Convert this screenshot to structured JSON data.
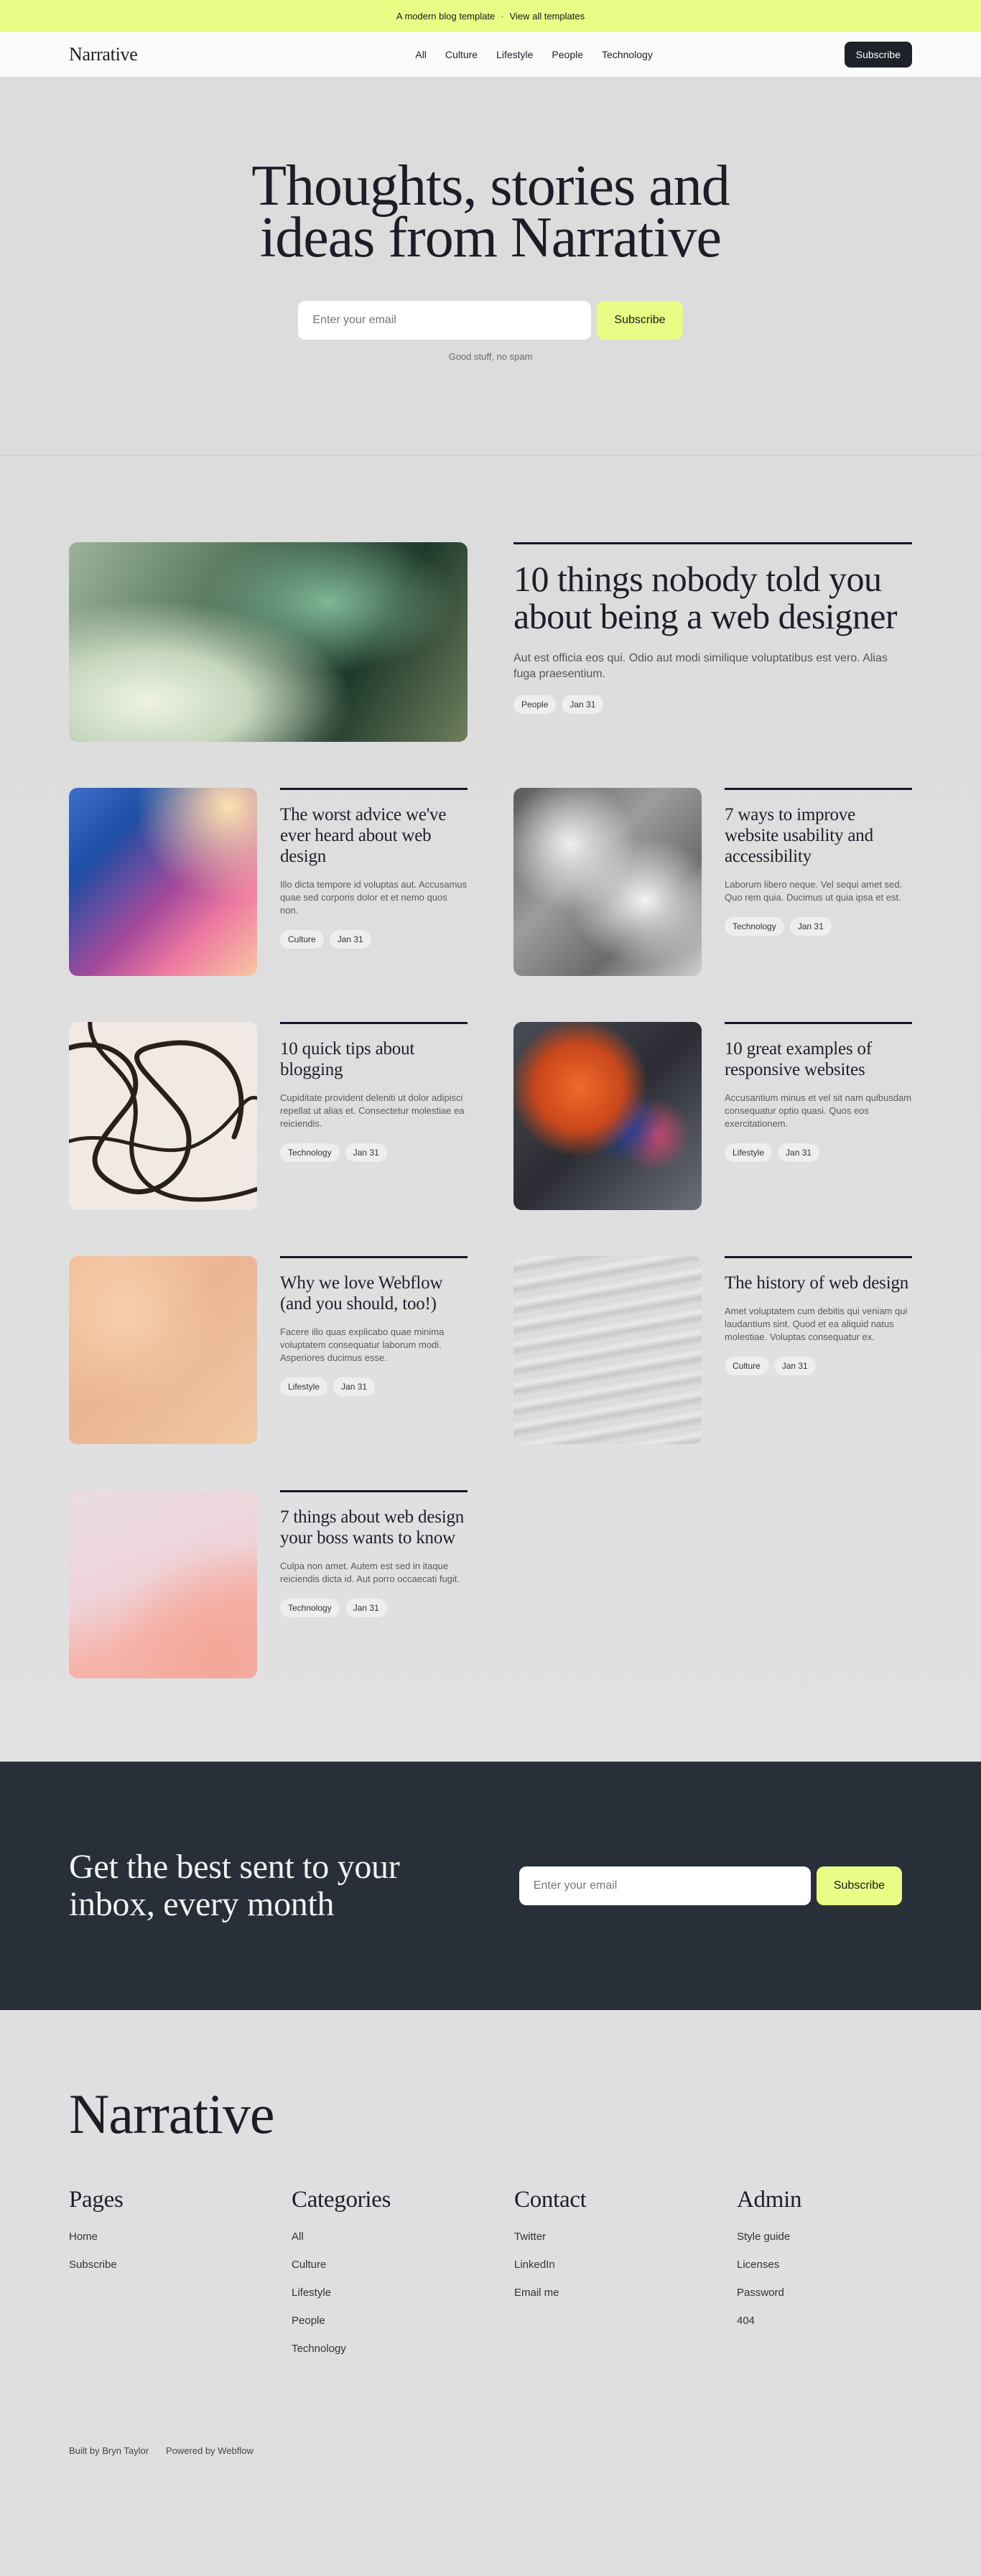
{
  "banner": {
    "text": "A modern blog template",
    "separator": "·",
    "link": "View all templates"
  },
  "nav": {
    "brand": "Narrative",
    "links": [
      "All",
      "Culture",
      "Lifestyle",
      "People",
      "Technology"
    ],
    "subscribe": "Subscribe"
  },
  "hero": {
    "title_line1": "Thoughts, stories and",
    "title_line2": "ideas from Narrative",
    "email_placeholder": "Enter your email",
    "button": "Subscribe",
    "note": "Good stuff, no spam"
  },
  "featured": {
    "title": "10 things nobody told you about being a web designer",
    "excerpt": "Aut est officia eos qui. Odio aut modi similique voluptatibus est vero. Alias fuga praesentium.",
    "tags": [
      "People",
      "Jan 31"
    ]
  },
  "posts": [
    {
      "title": "The worst advice we've ever heard about web design",
      "excerpt": "Illo dicta tempore id voluptas aut. Accusamus quae sed corporis dolor et et nemo quos non.",
      "tags": [
        "Culture",
        "Jan 31"
      ]
    },
    {
      "title": "7 ways to improve website usability and accessibility",
      "excerpt": "Laborum libero neque. Vel sequi amet sed. Quo rem quia. Ducimus ut quia ipsa et est.",
      "tags": [
        "Technology",
        "Jan 31"
      ]
    },
    {
      "title": "10 quick tips about blogging",
      "excerpt": "Cupiditate provident deleniti ut dolor adipisci repellat ut alias et. Consectetur molestiae ea reiciendis.",
      "tags": [
        "Technology",
        "Jan 31"
      ]
    },
    {
      "title": "10 great examples of responsive websites",
      "excerpt": "Accusantium minus et vel sit nam quibusdam consequatur optio quasi. Quos eos exercitationem.",
      "tags": [
        "Lifestyle",
        "Jan 31"
      ]
    },
    {
      "title": "Why we love Webflow (and you should, too!)",
      "excerpt": "Facere illo quas explicabo quae minima voluptatem consequatur laborum modi. Asperiores ducimus esse.",
      "tags": [
        "Lifestyle",
        "Jan 31"
      ]
    },
    {
      "title": "The history of web design",
      "excerpt": "Amet voluptatem cum debitis qui veniam qui laudantium sint. Quod et ea aliquid natus molestiae. Voluptas consequatur ex.",
      "tags": [
        "Culture",
        "Jan 31"
      ]
    },
    {
      "title": "7 things about web design your boss wants to know",
      "excerpt": "Culpa non amet. Autem est sed in itaque reiciendis dicta id. Aut porro occaecati fugit.",
      "tags": [
        "Technology",
        "Jan 31"
      ]
    }
  ],
  "newsletter": {
    "title": "Get the best sent to your inbox, every month",
    "email_placeholder": "Enter your email",
    "button": "Subscribe"
  },
  "footer": {
    "brand": "Narrative",
    "columns": [
      {
        "heading": "Pages",
        "links": [
          "Home",
          "Subscribe"
        ]
      },
      {
        "heading": "Categories",
        "links": [
          "All",
          "Culture",
          "Lifestyle",
          "People",
          "Technology"
        ]
      },
      {
        "heading": "Contact",
        "links": [
          "Twitter",
          "LinkedIn",
          "Email me"
        ]
      },
      {
        "heading": "Admin",
        "links": [
          "Style guide",
          "Licenses",
          "Password",
          "404"
        ]
      }
    ],
    "credits": [
      "Built by Bryn Taylor",
      "Powered by Webflow"
    ]
  },
  "colors": {
    "accent": "#e8fc86",
    "dark": "#292f38",
    "rule": "#1a1428"
  }
}
